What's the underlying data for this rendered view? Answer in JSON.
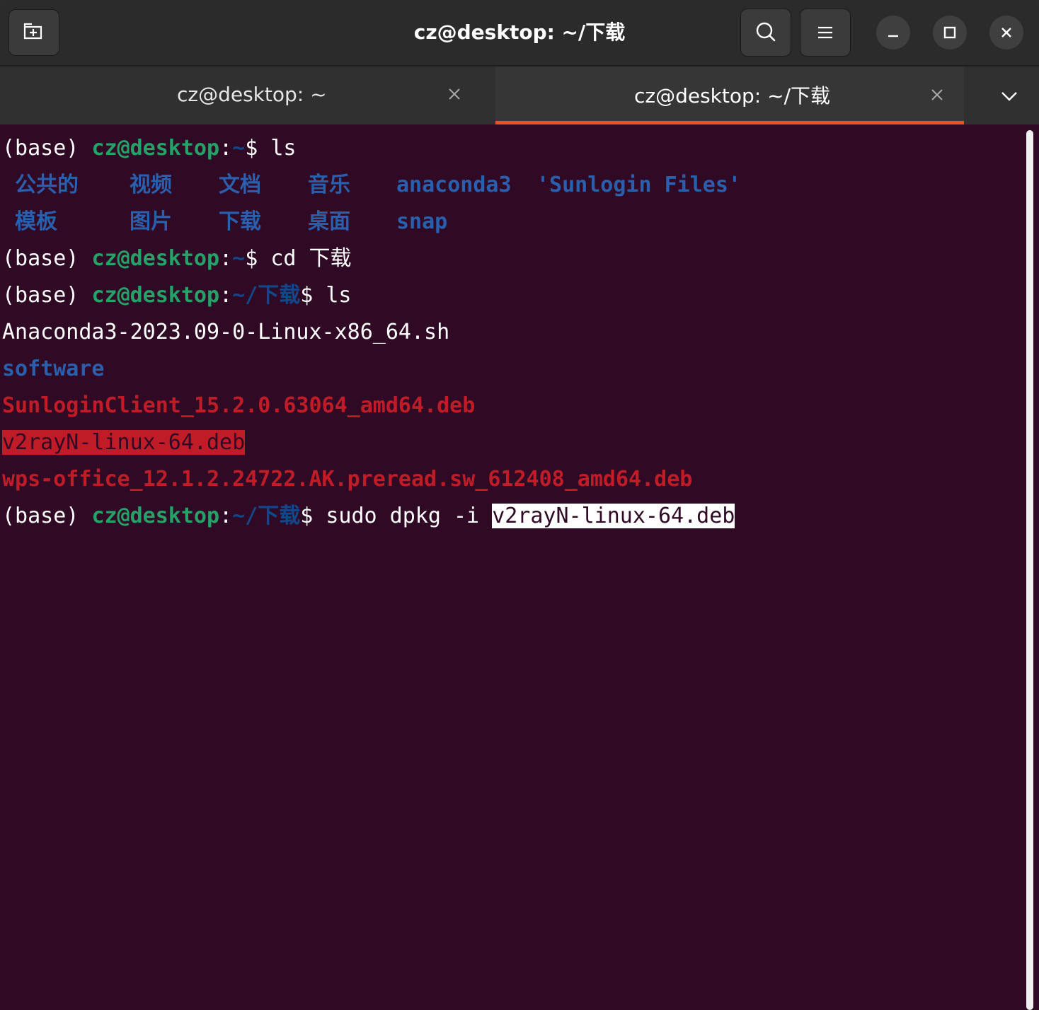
{
  "window": {
    "title": "cz@desktop: ~/下载"
  },
  "tabs": [
    {
      "label": "cz@desktop: ~",
      "active": false
    },
    {
      "label": "cz@desktop: ~/下载",
      "active": true
    }
  ],
  "icons": {
    "new_tab": "new-tab-icon",
    "search": "search-icon",
    "menu": "hamburger-menu-icon",
    "minimize": "minimize-icon",
    "maximize": "maximize-icon",
    "close": "close-icon",
    "tab_close": "tab-close-icon",
    "dropdown": "chevron-down-icon"
  },
  "colors": {
    "terminal_bg": "#300a24",
    "prompt_user": "#26a269",
    "prompt_path": "#12488b",
    "archive": "#c01c28",
    "accent": "#e95420"
  },
  "terminal": {
    "prompt": {
      "env": "(base) ",
      "user_host": "cz@desktop",
      "colon": ":",
      "home": "~",
      "download_path": "~/下载",
      "dollar": "$ "
    },
    "cmd1": "ls",
    "home_listing_row1": [
      "公共的",
      "视频",
      "文档",
      "音乐",
      "anaconda3",
      "'Sunlogin Files'"
    ],
    "home_listing_row2": [
      "模板",
      "图片",
      "下载",
      "桌面",
      "snap"
    ],
    "cmd2": "cd 下载",
    "cmd3": "ls",
    "download_listing": [
      "Anaconda3-2023.09-0-Linux-x86_64.sh",
      "software",
      "SunloginClient_15.2.0.63064_amd64.deb",
      "v2rayN-linux-64.deb",
      "wps-office_12.1.2.24722.AK.preread.sw_612408_amd64.deb"
    ],
    "cmd4_prefix": "sudo dpkg -i ",
    "cmd4_selected": "v2rayN-linux-64.deb"
  }
}
